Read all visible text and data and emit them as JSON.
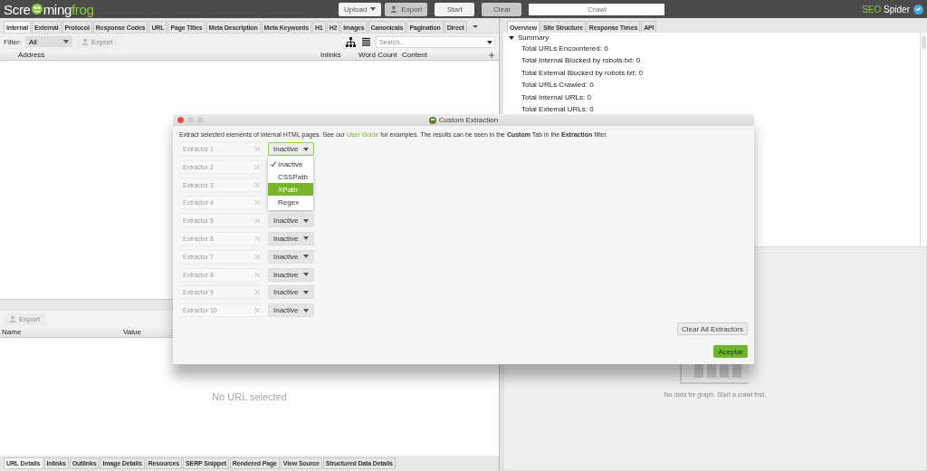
{
  "app_bar": {
    "logo": [
      {
        "kind": "text",
        "text": "Scre"
      },
      {
        "kind": "icon"
      },
      {
        "kind": "text",
        "text": "ming"
      },
      {
        "kind": "accent",
        "text": "frog"
      }
    ],
    "upload": "Upload",
    "export": "Export",
    "start": "Start",
    "clear": "Clear",
    "crawl_field": {
      "placeholder": "Crawl"
    },
    "product": {
      "accent": "SEO",
      "name": "Spider"
    }
  },
  "main_tabs": [
    {
      "label": "Internal",
      "selected": true
    },
    {
      "label": "External",
      "selected": false
    },
    {
      "label": "Protocol",
      "selected": false
    },
    {
      "label": "Response Codes",
      "selected": false
    },
    {
      "label": "URL",
      "selected": false
    },
    {
      "label": "Page Titles",
      "selected": false
    },
    {
      "label": "Meta Description",
      "selected": false
    },
    {
      "label": "Meta Keywords",
      "selected": false
    },
    {
      "label": "H1",
      "selected": false
    },
    {
      "label": "H2",
      "selected": false
    },
    {
      "label": "Images",
      "selected": false
    },
    {
      "label": "Canonicals",
      "selected": false
    },
    {
      "label": "Pagination",
      "selected": false
    },
    {
      "label": "Direct",
      "selected": false
    }
  ],
  "filter_bar": {
    "label": "Filter:",
    "filter": "All",
    "export": "Export",
    "views": [
      {
        "kind": "tree",
        "selected": false
      },
      {
        "kind": "list",
        "selected": true
      }
    ],
    "search": {
      "placeholder": "Search..."
    }
  },
  "table": {
    "columns": [
      "Address",
      "Inlinks",
      "Word Count",
      "Content"
    ]
  },
  "details": {
    "export": "Export",
    "columns": [
      "Name",
      "Value"
    ],
    "empty": "No URL selected"
  },
  "bottom_tabs": [
    {
      "label": "URL Details",
      "selected": true
    },
    {
      "label": "Inlinks",
      "selected": false
    },
    {
      "label": "Outlinks",
      "selected": false
    },
    {
      "label": "Image Details",
      "selected": false
    },
    {
      "label": "Resources",
      "selected": false
    },
    {
      "label": "SERP Snippet",
      "selected": false
    },
    {
      "label": "Rendered Page",
      "selected": false
    },
    {
      "label": "View Source",
      "selected": false
    },
    {
      "label": "Structured Data Details",
      "selected": false
    }
  ],
  "side_tabs": [
    {
      "label": "Overview",
      "selected": true
    },
    {
      "label": "Site Structure",
      "selected": false
    },
    {
      "label": "Response Times",
      "selected": false
    },
    {
      "label": "API",
      "selected": false
    }
  ],
  "summary": {
    "label": "Summary",
    "expanded": true,
    "children": [
      {
        "label": "Total URLs Encountered: 0"
      },
      {
        "label": "Total Internal Blocked by robots.txt: 0"
      },
      {
        "label": "Total External Blocked by robots.txt: 0"
      },
      {
        "label": "Total URLs Crawled: 0"
      },
      {
        "label": "Total Internal URLs: 0"
      },
      {
        "label": "Total External URLs: 0"
      }
    ]
  },
  "graph": {
    "empty": "No data for graph. Start a crawl first."
  },
  "dialog": {
    "title": "Custom Extraction",
    "description": {
      "before": "Extract selected elements of internal HTML pages. See our ",
      "link": "User Guide",
      "after": " for examples. The results can be seen in the **Custom** Tab in the **Extraction** filter."
    },
    "extractors": [
      {
        "placeholder": "Extractor 1",
        "mode": "Inactive",
        "focused": true,
        "menu": [
          {
            "label": "Inactive",
            "checked": true,
            "selected": false
          },
          {
            "label": "CSSPath",
            "checked": false,
            "selected": false
          },
          {
            "label": "XPath",
            "checked": false,
            "selected": true
          },
          {
            "label": "Regex",
            "checked": false,
            "selected": false
          }
        ]
      },
      {
        "placeholder": "Extractor 2"
      },
      {
        "placeholder": "Extractor 3"
      },
      {
        "placeholder": "Extractor 4"
      },
      {
        "placeholder": "Extractor 5",
        "mode": "Inactive",
        "focused": false
      },
      {
        "placeholder": "Extractor 6",
        "mode": "Inactive",
        "focused": false
      },
      {
        "placeholder": "Extractor 7",
        "mode": "Inactive",
        "focused": false
      },
      {
        "placeholder": "Extractor 8",
        "mode": "Inactive",
        "focused": false
      },
      {
        "placeholder": "Extractor 9",
        "mode": "Inactive",
        "focused": false
      },
      {
        "placeholder": "Extractor 10",
        "mode": "Inactive",
        "focused": false
      }
    ],
    "clear_all": "Clear All Extractors",
    "ok": "Aceptar"
  }
}
